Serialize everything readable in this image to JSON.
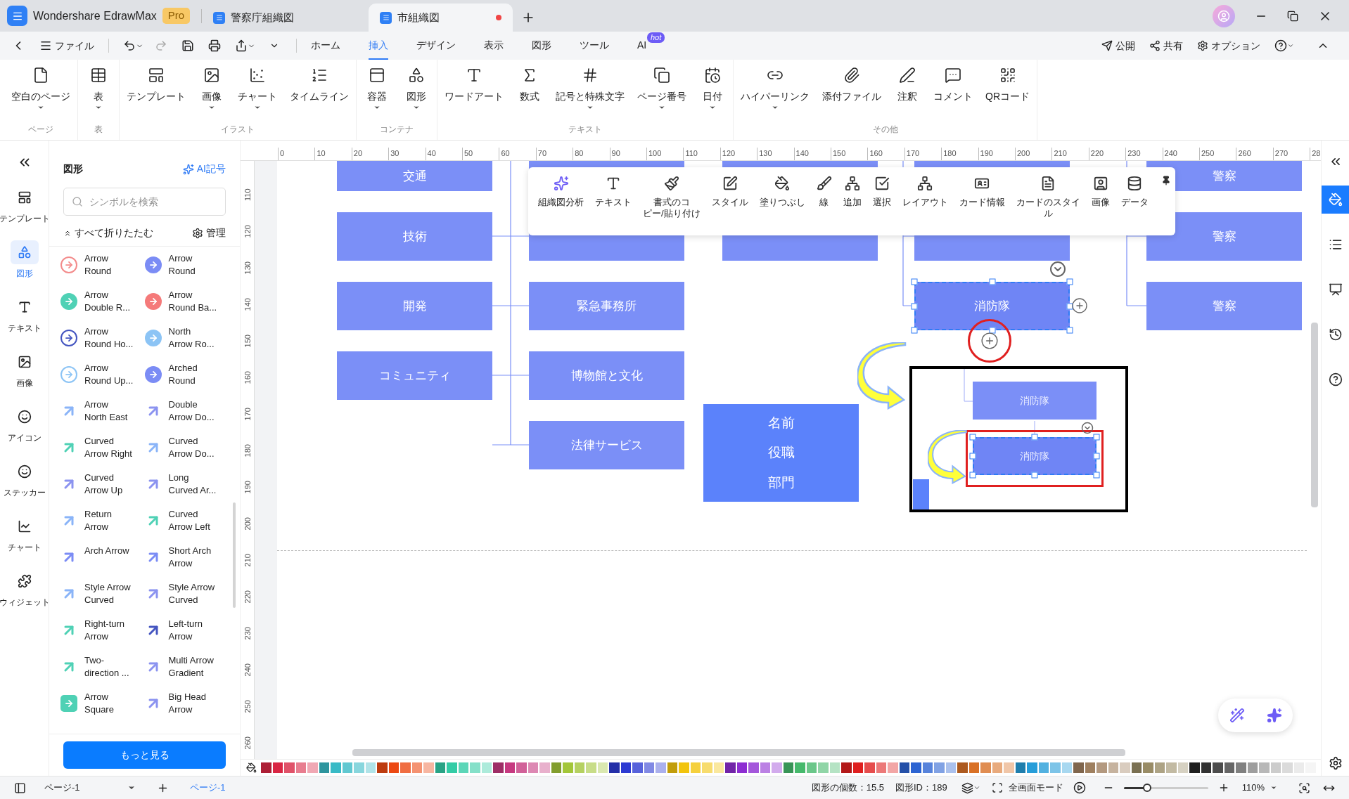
{
  "title_bar": {
    "app": "Wondershare EdrawMax",
    "badge": "Pro",
    "tabs": [
      {
        "label": "警察庁組織図",
        "selected": false,
        "modified": false
      },
      {
        "label": "市組織図",
        "selected": true,
        "modified": true
      }
    ]
  },
  "menu_bar": {
    "file": "ファイル",
    "tabs": [
      {
        "label": "ホーム",
        "selected": false
      },
      {
        "label": "挿入",
        "selected": true
      },
      {
        "label": "デザイン",
        "selected": false
      },
      {
        "label": "表示",
        "selected": false
      },
      {
        "label": "図形",
        "selected": false
      },
      {
        "label": "ツール",
        "selected": false
      },
      {
        "label": "AI",
        "selected": false,
        "badge": "hot"
      }
    ],
    "actions": [
      "公開",
      "共有",
      "オプション"
    ]
  },
  "ribbon": {
    "groups": [
      {
        "label": "ページ",
        "items": [
          {
            "label": "空白のページ",
            "has_menu": true
          }
        ]
      },
      {
        "label": "表",
        "items": [
          {
            "label": "表",
            "has_menu": true
          }
        ]
      },
      {
        "label": "イラスト",
        "items": [
          {
            "label": "テンプレート",
            "has_menu": false
          },
          {
            "label": "画像",
            "has_menu": true
          },
          {
            "label": "チャート",
            "has_menu": true
          },
          {
            "label": "タイムライン",
            "has_menu": false
          }
        ]
      },
      {
        "label": "コンテナ",
        "items": [
          {
            "label": "容器",
            "has_menu": true
          },
          {
            "label": "図形",
            "has_menu": true
          }
        ]
      },
      {
        "label": "テキスト",
        "items": [
          {
            "label": "ワードアート",
            "has_menu": false
          },
          {
            "label": "数式",
            "has_menu": false
          },
          {
            "label": "記号と特殊文字",
            "has_menu": true
          },
          {
            "label": "ページ番号",
            "has_menu": true
          },
          {
            "label": "日付",
            "has_menu": true
          }
        ]
      },
      {
        "label": "その他",
        "items": [
          {
            "label": "ハイパーリンク",
            "has_menu": true
          },
          {
            "label": "添付ファイル",
            "has_menu": false
          },
          {
            "label": "注釈",
            "has_menu": false
          },
          {
            "label": "コメント",
            "has_menu": false
          },
          {
            "label": "QRコード",
            "has_menu": false
          }
        ]
      }
    ]
  },
  "left_rail": {
    "items": [
      {
        "label": "テンプレート",
        "selected": false
      },
      {
        "label": "図形",
        "selected": true
      },
      {
        "label": "テキスト",
        "selected": false
      },
      {
        "label": "画像",
        "selected": false
      },
      {
        "label": "アイコン",
        "selected": false
      },
      {
        "label": "ステッカー",
        "selected": false
      },
      {
        "label": "チャート",
        "selected": false
      },
      {
        "label": "ウィジェット",
        "selected": false
      }
    ]
  },
  "shapes_panel": {
    "title": "図形",
    "ai_button": "AI記号",
    "search": {
      "placeholder": "シンボルを検索"
    },
    "collapse_all": "すべて折りたたむ",
    "manage": "管理",
    "more_button": "もっと見る",
    "items": [
      {
        "lines": [
          "Arrow",
          "Round"
        ],
        "kind": "ring",
        "color": "#f38b8b"
      },
      {
        "lines": [
          "Arrow",
          "Round"
        ],
        "kind": "disc",
        "color": "#7b8cf5"
      },
      {
        "lines": [
          "Arrow",
          "Double R..."
        ],
        "kind": "disc",
        "color": "#4fd1b5"
      },
      {
        "lines": [
          "Arrow",
          "Round Ba..."
        ],
        "kind": "disc",
        "color": "#f57a7a"
      },
      {
        "lines": [
          "Arrow",
          "Round Ho..."
        ],
        "kind": "ring",
        "color": "#4455c0"
      },
      {
        "lines": [
          "North",
          "Arrow Ro..."
        ],
        "kind": "disc",
        "color": "#8cc4f5"
      },
      {
        "lines": [
          "Arrow",
          "Round Up..."
        ],
        "kind": "ring",
        "color": "#8cc4f5"
      },
      {
        "lines": [
          "Arched",
          "Round"
        ],
        "kind": "disc",
        "color": "#7b8cf5"
      },
      {
        "lines": [
          "Arrow",
          "North East"
        ],
        "kind": "arrow",
        "color": "#8ab4f8"
      },
      {
        "lines": [
          "Double",
          "Arrow Do..."
        ],
        "kind": "arrow",
        "color": "#8b93f0"
      },
      {
        "lines": [
          "Curved",
          "Arrow Right"
        ],
        "kind": "arrow",
        "color": "#4fd1b5"
      },
      {
        "lines": [
          "Curved",
          "Arrow Do..."
        ],
        "kind": "arrow",
        "color": "#8ab4f8"
      },
      {
        "lines": [
          "Curved",
          "Arrow Up"
        ],
        "kind": "arrow",
        "color": "#8b93f0"
      },
      {
        "lines": [
          "Long",
          "Curved Ar..."
        ],
        "kind": "arrow",
        "color": "#8b93f0"
      },
      {
        "lines": [
          "Return",
          "Arrow"
        ],
        "kind": "arrow",
        "color": "#8ab4f8"
      },
      {
        "lines": [
          "Curved",
          "Arrow Left"
        ],
        "kind": "arrow",
        "color": "#4fd1b5"
      },
      {
        "lines": [
          "Arch Arrow"
        ],
        "kind": "arrow",
        "color": "#7b8cf5"
      },
      {
        "lines": [
          "Short Arch",
          "Arrow"
        ],
        "kind": "arrow",
        "color": "#7b8cf5"
      },
      {
        "lines": [
          "Style Arrow",
          "Curved"
        ],
        "kind": "arrow",
        "color": "#8ab4f8"
      },
      {
        "lines": [
          "Style Arrow",
          "Curved"
        ],
        "kind": "arrow",
        "color": "#8b93f0"
      },
      {
        "lines": [
          "Right-turn",
          "Arrow"
        ],
        "kind": "arrow",
        "color": "#4fd1b5"
      },
      {
        "lines": [
          "Left-turn",
          "Arrow"
        ],
        "kind": "arrow",
        "color": "#4455c0"
      },
      {
        "lines": [
          "Two-",
          "direction ..."
        ],
        "kind": "arrow",
        "color": "#4fd1b5"
      },
      {
        "lines": [
          "Multi Arrow",
          "Gradient"
        ],
        "kind": "arrow",
        "color": "#8b93f0"
      },
      {
        "lines": [
          "Arrow",
          "Square"
        ],
        "kind": "square",
        "color": "#4fd1b5"
      },
      {
        "lines": [
          "Big Head",
          "Arrow"
        ],
        "kind": "arrow",
        "color": "#8b93f0"
      }
    ]
  },
  "ruler": {
    "x_labels": [
      "0",
      "10",
      "20",
      "30",
      "40",
      "50",
      "60",
      "70",
      "80",
      "90",
      "100",
      "110",
      "120",
      "130",
      "140",
      "150",
      "160",
      "170",
      "180",
      "190",
      "200",
      "210",
      "220",
      "230",
      "240",
      "250",
      "260",
      "270",
      "28"
    ],
    "y_labels": [
      "110",
      "120",
      "130",
      "140",
      "150",
      "160",
      "170",
      "180",
      "190",
      "200",
      "210",
      "220",
      "230",
      "240",
      "250",
      "260"
    ]
  },
  "org_chart": {
    "nodes": [
      {
        "text": "交通",
        "selected": false
      },
      {
        "text": "技術",
        "selected": false
      },
      {
        "text": "開発",
        "selected": false
      },
      {
        "text": "コミュニティ",
        "selected": false
      },
      {
        "text": "緊急事務所",
        "selected": false
      },
      {
        "text": "博物館と文化",
        "selected": false
      },
      {
        "text": "法律サービス",
        "selected": false
      },
      {
        "text": "消防隊",
        "selected": true
      },
      {
        "text": "警察",
        "selected": false
      },
      {
        "text": "警察",
        "selected": false
      },
      {
        "text": "警察",
        "selected": false
      }
    ]
  },
  "card": {
    "lines": [
      "名前",
      "役職",
      "部門"
    ]
  },
  "inset": {
    "nodes": [
      {
        "text": "消防隊",
        "selected": false
      },
      {
        "text": "消防隊",
        "selected": true
      }
    ]
  },
  "context_toolbar": {
    "items": [
      {
        "lines": [
          "組織図分析"
        ]
      },
      {
        "lines": [
          "テキスト"
        ]
      },
      {
        "lines": [
          "書式のコ",
          "ピー/貼り付け"
        ]
      },
      {
        "lines": [
          "スタイル"
        ]
      },
      {
        "lines": [
          "塗りつぶし"
        ]
      },
      {
        "lines": [
          "線"
        ]
      },
      {
        "lines": [
          "追加"
        ]
      },
      {
        "lines": [
          "選択"
        ]
      },
      {
        "lines": [
          "レイアウト"
        ]
      },
      {
        "lines": [
          "カード情報"
        ]
      },
      {
        "lines": [
          "カードのスタイ",
          "ル"
        ]
      },
      {
        "lines": [
          "画像"
        ]
      },
      {
        "lines": [
          "データ"
        ]
      }
    ]
  },
  "right_rail": {
    "items": [
      {
        "selected": true
      },
      {
        "selected": false
      },
      {
        "selected": false
      },
      {
        "selected": false
      },
      {
        "selected": false
      }
    ]
  },
  "status_bar": {
    "page_select": "ページ-1",
    "page_tabs": [
      {
        "label": "ページ-1",
        "selected": true
      }
    ],
    "shape_count": "図形の個数：15.5",
    "shape_id": "図形ID：189",
    "fullscreen": "全画面モード",
    "zoom": {
      "level": 0.28,
      "value": "110%"
    }
  }
}
